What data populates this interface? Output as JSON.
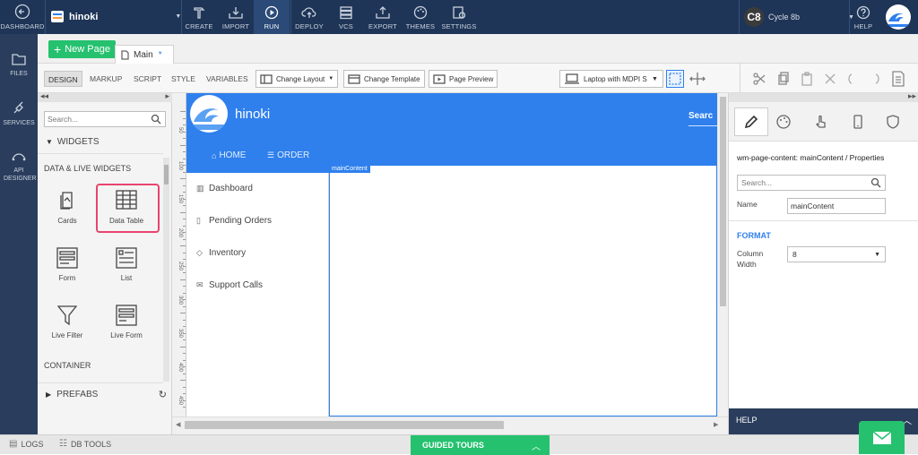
{
  "topbar": {
    "dashboard": "DASHBOARD",
    "project_name": "hinoki",
    "create": "CREATE",
    "import": "IMPORT",
    "run": "RUN",
    "deploy": "DEPLOY",
    "vcs": "VCS",
    "export": "EXPORT",
    "themes": "THEMES",
    "settings": "SETTINGS",
    "user_initials": "C8",
    "user_name": "Cycle 8b",
    "help": "HELP"
  },
  "leftrail": {
    "files": "FILES",
    "services": "SERVICES",
    "api_designer": "API DESIGNER"
  },
  "tabs": {
    "new_page": "New Page",
    "main_tab": "Main",
    "dirty_marker": "*"
  },
  "toolbar": {
    "design": "DESIGN",
    "markup": "MARKUP",
    "script": "SCRIPT",
    "style": "STYLE",
    "variables": "VARIABLES",
    "change_layout": "Change Layout",
    "change_template": "Change Template",
    "page_preview": "Page Preview",
    "device": "Laptop with MDPI S"
  },
  "widgets": {
    "search_placeholder": "Search...",
    "widgets_header": "WIDGETS",
    "data_live_header": "DATA & LIVE WIDGETS",
    "items": [
      {
        "label": "Cards",
        "icon": "cards-icon"
      },
      {
        "label": "Data Table",
        "icon": "data-table-icon"
      },
      {
        "label": "Form",
        "icon": "form-icon"
      },
      {
        "label": "List",
        "icon": "list-icon"
      },
      {
        "label": "Live Filter",
        "icon": "filter-icon"
      },
      {
        "label": "Live Form",
        "icon": "live-form-icon"
      }
    ],
    "container_header": "CONTAINER",
    "prefabs_header": "PREFABS"
  },
  "canvas": {
    "app_title": "hinoki",
    "search_label": "Searc",
    "nav": {
      "home": "HOME",
      "order": "ORDER"
    },
    "main_content_label": "mainContent",
    "sidebar_items": [
      {
        "label": "Dashboard",
        "icon": "bar-chart-icon"
      },
      {
        "label": "Pending Orders",
        "icon": "document-icon"
      },
      {
        "label": "Inventory",
        "icon": "tag-icon"
      },
      {
        "label": "Support Calls",
        "icon": "mail-icon"
      }
    ],
    "ruler_ticks": [
      "50",
      "100",
      "150",
      "200",
      "250",
      "300",
      "350",
      "400",
      "450"
    ]
  },
  "properties": {
    "heading": "wm-page-content: mainContent / Properties",
    "search_placeholder": "Search...",
    "name_label": "Name",
    "name_value": "mainContent",
    "format_header": "FORMAT",
    "column_width_label_1": "Column",
    "column_width_label_2": "Width",
    "column_width_value": "8",
    "help": "HELP"
  },
  "bottombar": {
    "logs": "LOGS",
    "db_tools": "DB TOOLS",
    "guided_tours": "GUIDED TOURS"
  },
  "colors": {
    "topbar": "#1f3557",
    "rail": "#2a3d5c",
    "accent_blue": "#2f80ed",
    "green": "#25c16f",
    "highlight_pink": "#e8446e"
  }
}
